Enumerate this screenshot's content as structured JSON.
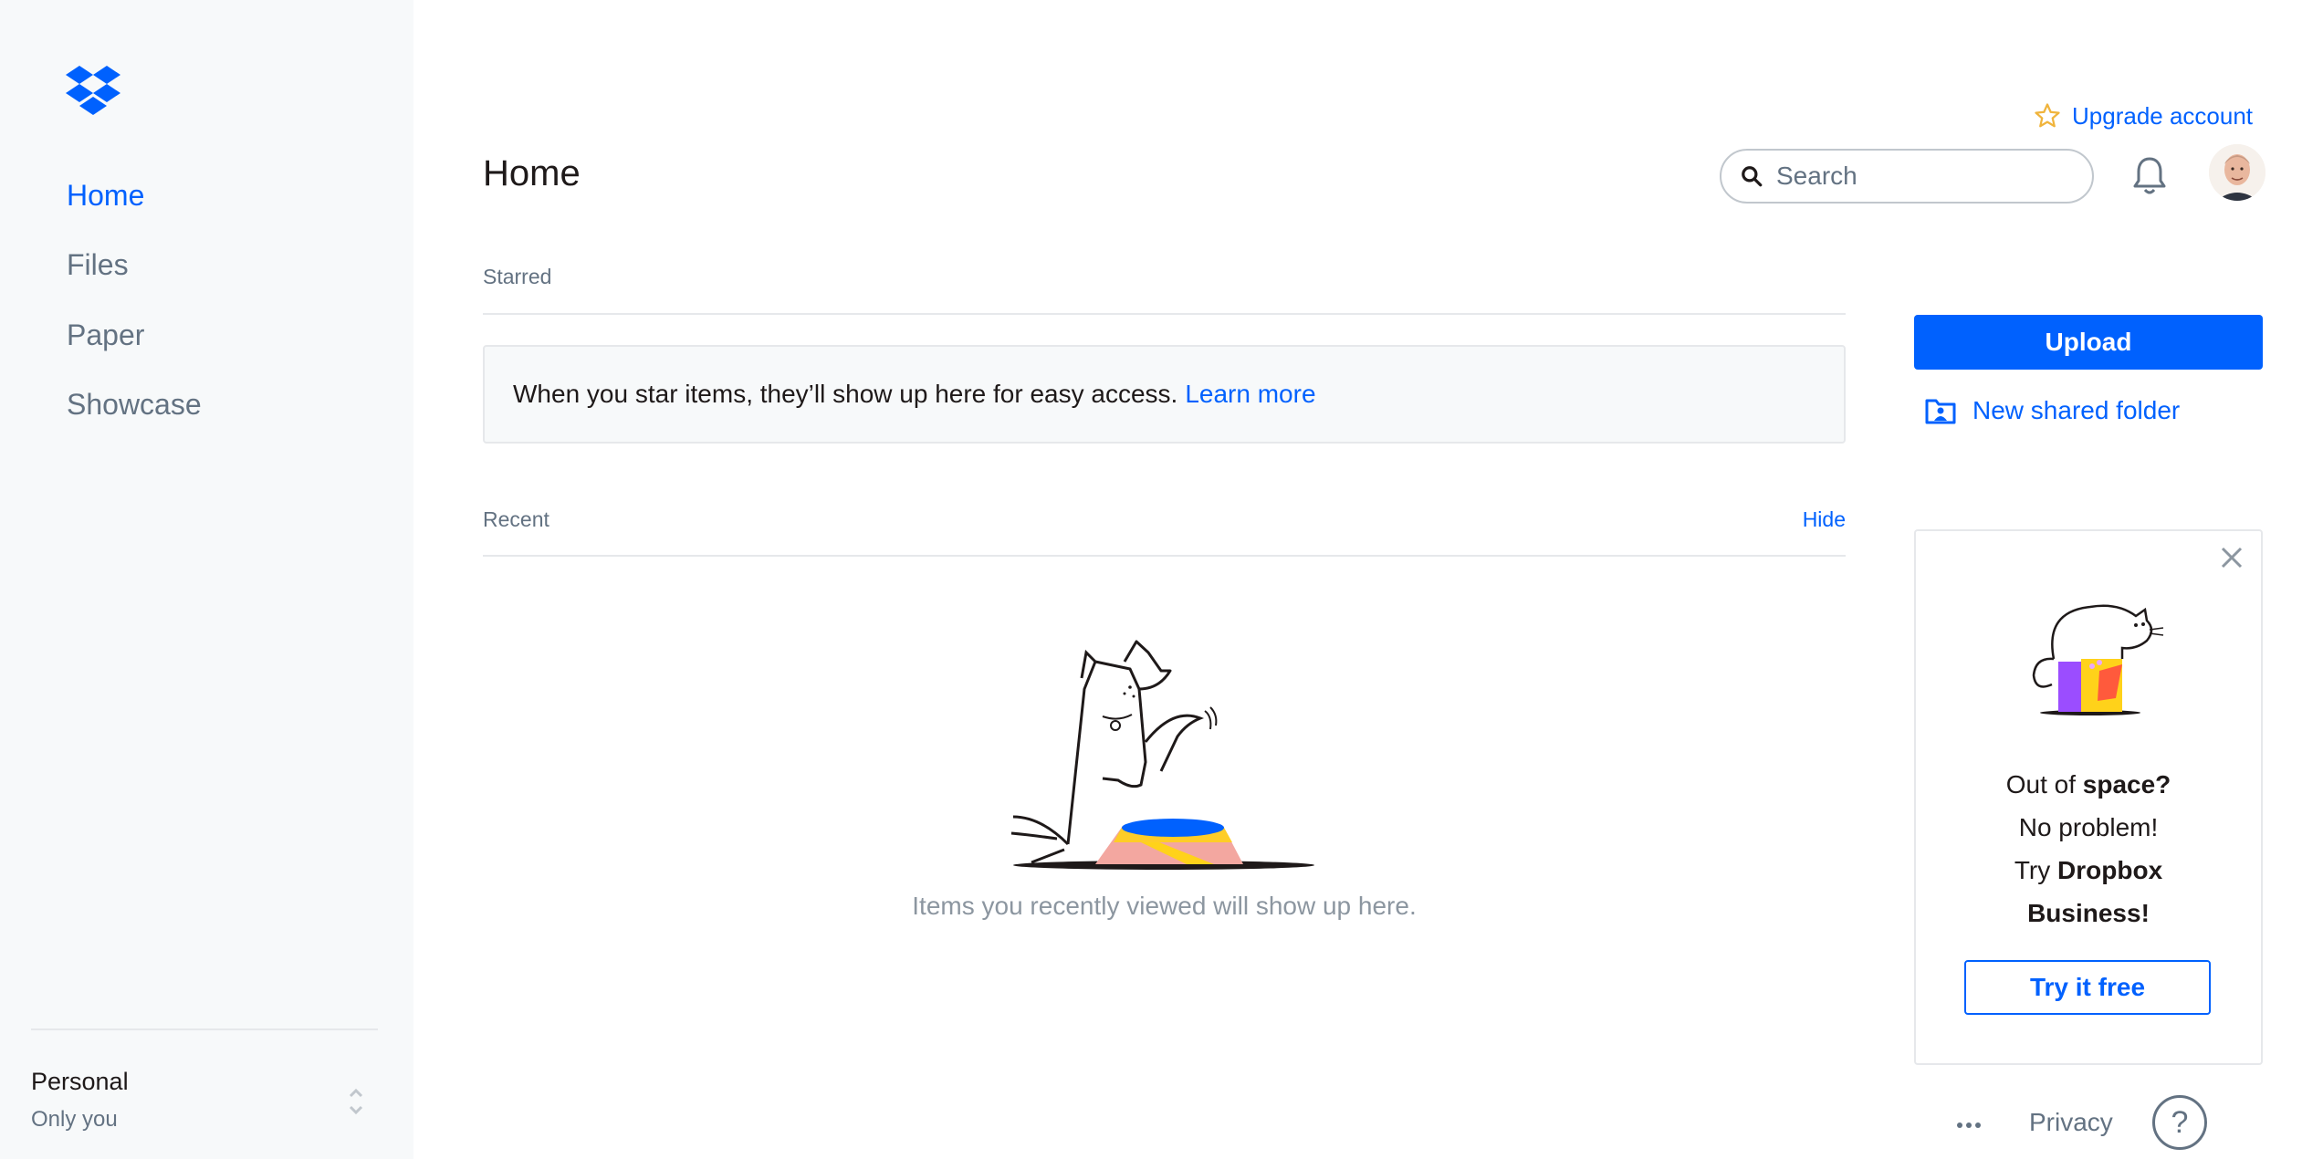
{
  "sidebar": {
    "logo": "dropbox-logo",
    "items": [
      {
        "label": "Home",
        "active": true
      },
      {
        "label": "Files"
      },
      {
        "label": "Paper"
      },
      {
        "label": "Showcase"
      }
    ],
    "account": {
      "name": "Personal",
      "sub": "Only you"
    }
  },
  "header": {
    "title": "Home",
    "upgrade_label": "Upgrade account",
    "search_placeholder": "Search"
  },
  "starred": {
    "label": "Starred",
    "message": "When you star items, they’ll show up here for easy access.",
    "link": "Learn more"
  },
  "recent": {
    "label": "Recent",
    "hide": "Hide",
    "empty": "Items you recently viewed will show up here."
  },
  "actions": {
    "upload": "Upload",
    "new_shared_folder": "New shared folder"
  },
  "promo": {
    "line1_a": "Out of ",
    "line1_b": "space?",
    "line2": "No problem!",
    "line3_a": "Try ",
    "line3_b": "Dropbox",
    "line4": "Business!",
    "cta": "Try it free"
  },
  "footer": {
    "privacy": "Privacy",
    "help": "?"
  },
  "colors": {
    "accent": "#0061fe",
    "sidebar_bg": "#f7f9fa",
    "muted_text": "#637282"
  }
}
